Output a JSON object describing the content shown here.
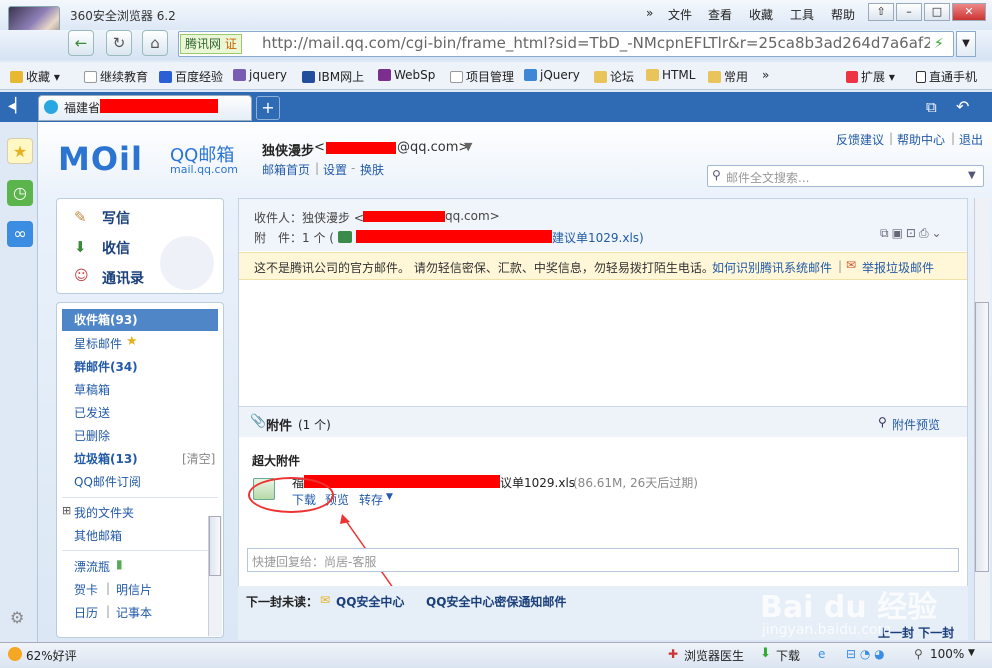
{
  "browser": {
    "app_name": "360安全浏览器 6.2",
    "menus": [
      "»",
      "文件",
      "查看",
      "收藏",
      "工具",
      "帮助"
    ],
    "window_buttons": [
      "⇧",
      "–",
      "□",
      "✕"
    ],
    "site_badge": "腾讯网",
    "site_badge_mark": "证",
    "url": "http://mail.qq.com/cgi-bin/frame_html?sid=TbD_-NMcpnEFLTlr&r=25ca8b3ad264d7a6af21",
    "bookmarks": [
      "收藏",
      "继续教育",
      "百度经验",
      "jquery",
      "IBM网上",
      "WebSp",
      "项目管理",
      "jQuery",
      "论坛",
      "HTML",
      "常用",
      "»",
      "扩展",
      "直通手机"
    ],
    "tab_title": "福建省"
  },
  "mail": {
    "logo": "MOil",
    "logo_title": "QQ邮箱",
    "logo_sub": "mail.qq.com",
    "user_name": "独侠漫步",
    "user_email_suffix": "@qq.com>",
    "top_links": [
      "邮箱首页",
      "设置",
      "换肤"
    ],
    "right_links": [
      "反馈建议",
      "帮助中心",
      "退出"
    ],
    "search_placeholder": "邮件全文搜索...",
    "nav_main": [
      "写信",
      "收信",
      "通讯录"
    ],
    "folders": {
      "inbox": "收件箱(93)",
      "star": "星标邮件",
      "group": "群邮件(34)",
      "draft": "草稿箱",
      "sent": "已发送",
      "deleted": "已删除",
      "spam": "垃圾箱(13)",
      "spam_clear": "[清空]",
      "subscribe": "QQ邮件订阅",
      "my_folders": "我的文件夹",
      "other": "其他邮箱",
      "bottle": "漂流瓶",
      "card": "贺卡",
      "postcard": "明信片",
      "calendar": "日历",
      "notes": "记事本"
    },
    "recipient_label": "收件人：独侠漫步 <",
    "recipient_suffix": "qq.com>",
    "attachment_label": "附　件：1 个 (",
    "attachment_suffix": "建议单1029.xls)",
    "warning": "这不是腾讯公司的官方邮件。 请勿轻信密保、汇款、中奖信息，勿轻易拨打陌生电话。",
    "warning_link1": "如何识别腾讯系统邮件",
    "warning_link2": "举报垃圾邮件",
    "att_title": "附件",
    "att_count": "(1 个)",
    "att_preview": "附件预览",
    "big_att": "超大附件",
    "file_prefix": "福",
    "file_suffix": "议单1029.xls",
    "file_meta": "(86.61M, 26天后过期)",
    "actions": [
      "下载",
      "预览",
      "转存"
    ],
    "reply_placeholder": "快捷回复给：尚居-客服overline",
    "next_label": "下一封未读：",
    "next_sender": "QQ安全中心",
    "next_subject": "QQ安全中心密保通知邮件",
    "nav_bottom": "上一封 下一封"
  },
  "status": {
    "left": "62%好评",
    "items": [
      "浏览器医生",
      "下载"
    ],
    "zoom": "100%"
  },
  "watermark": {
    "main": "Bai du 经验",
    "sub": "jingyan.baidu.com"
  }
}
